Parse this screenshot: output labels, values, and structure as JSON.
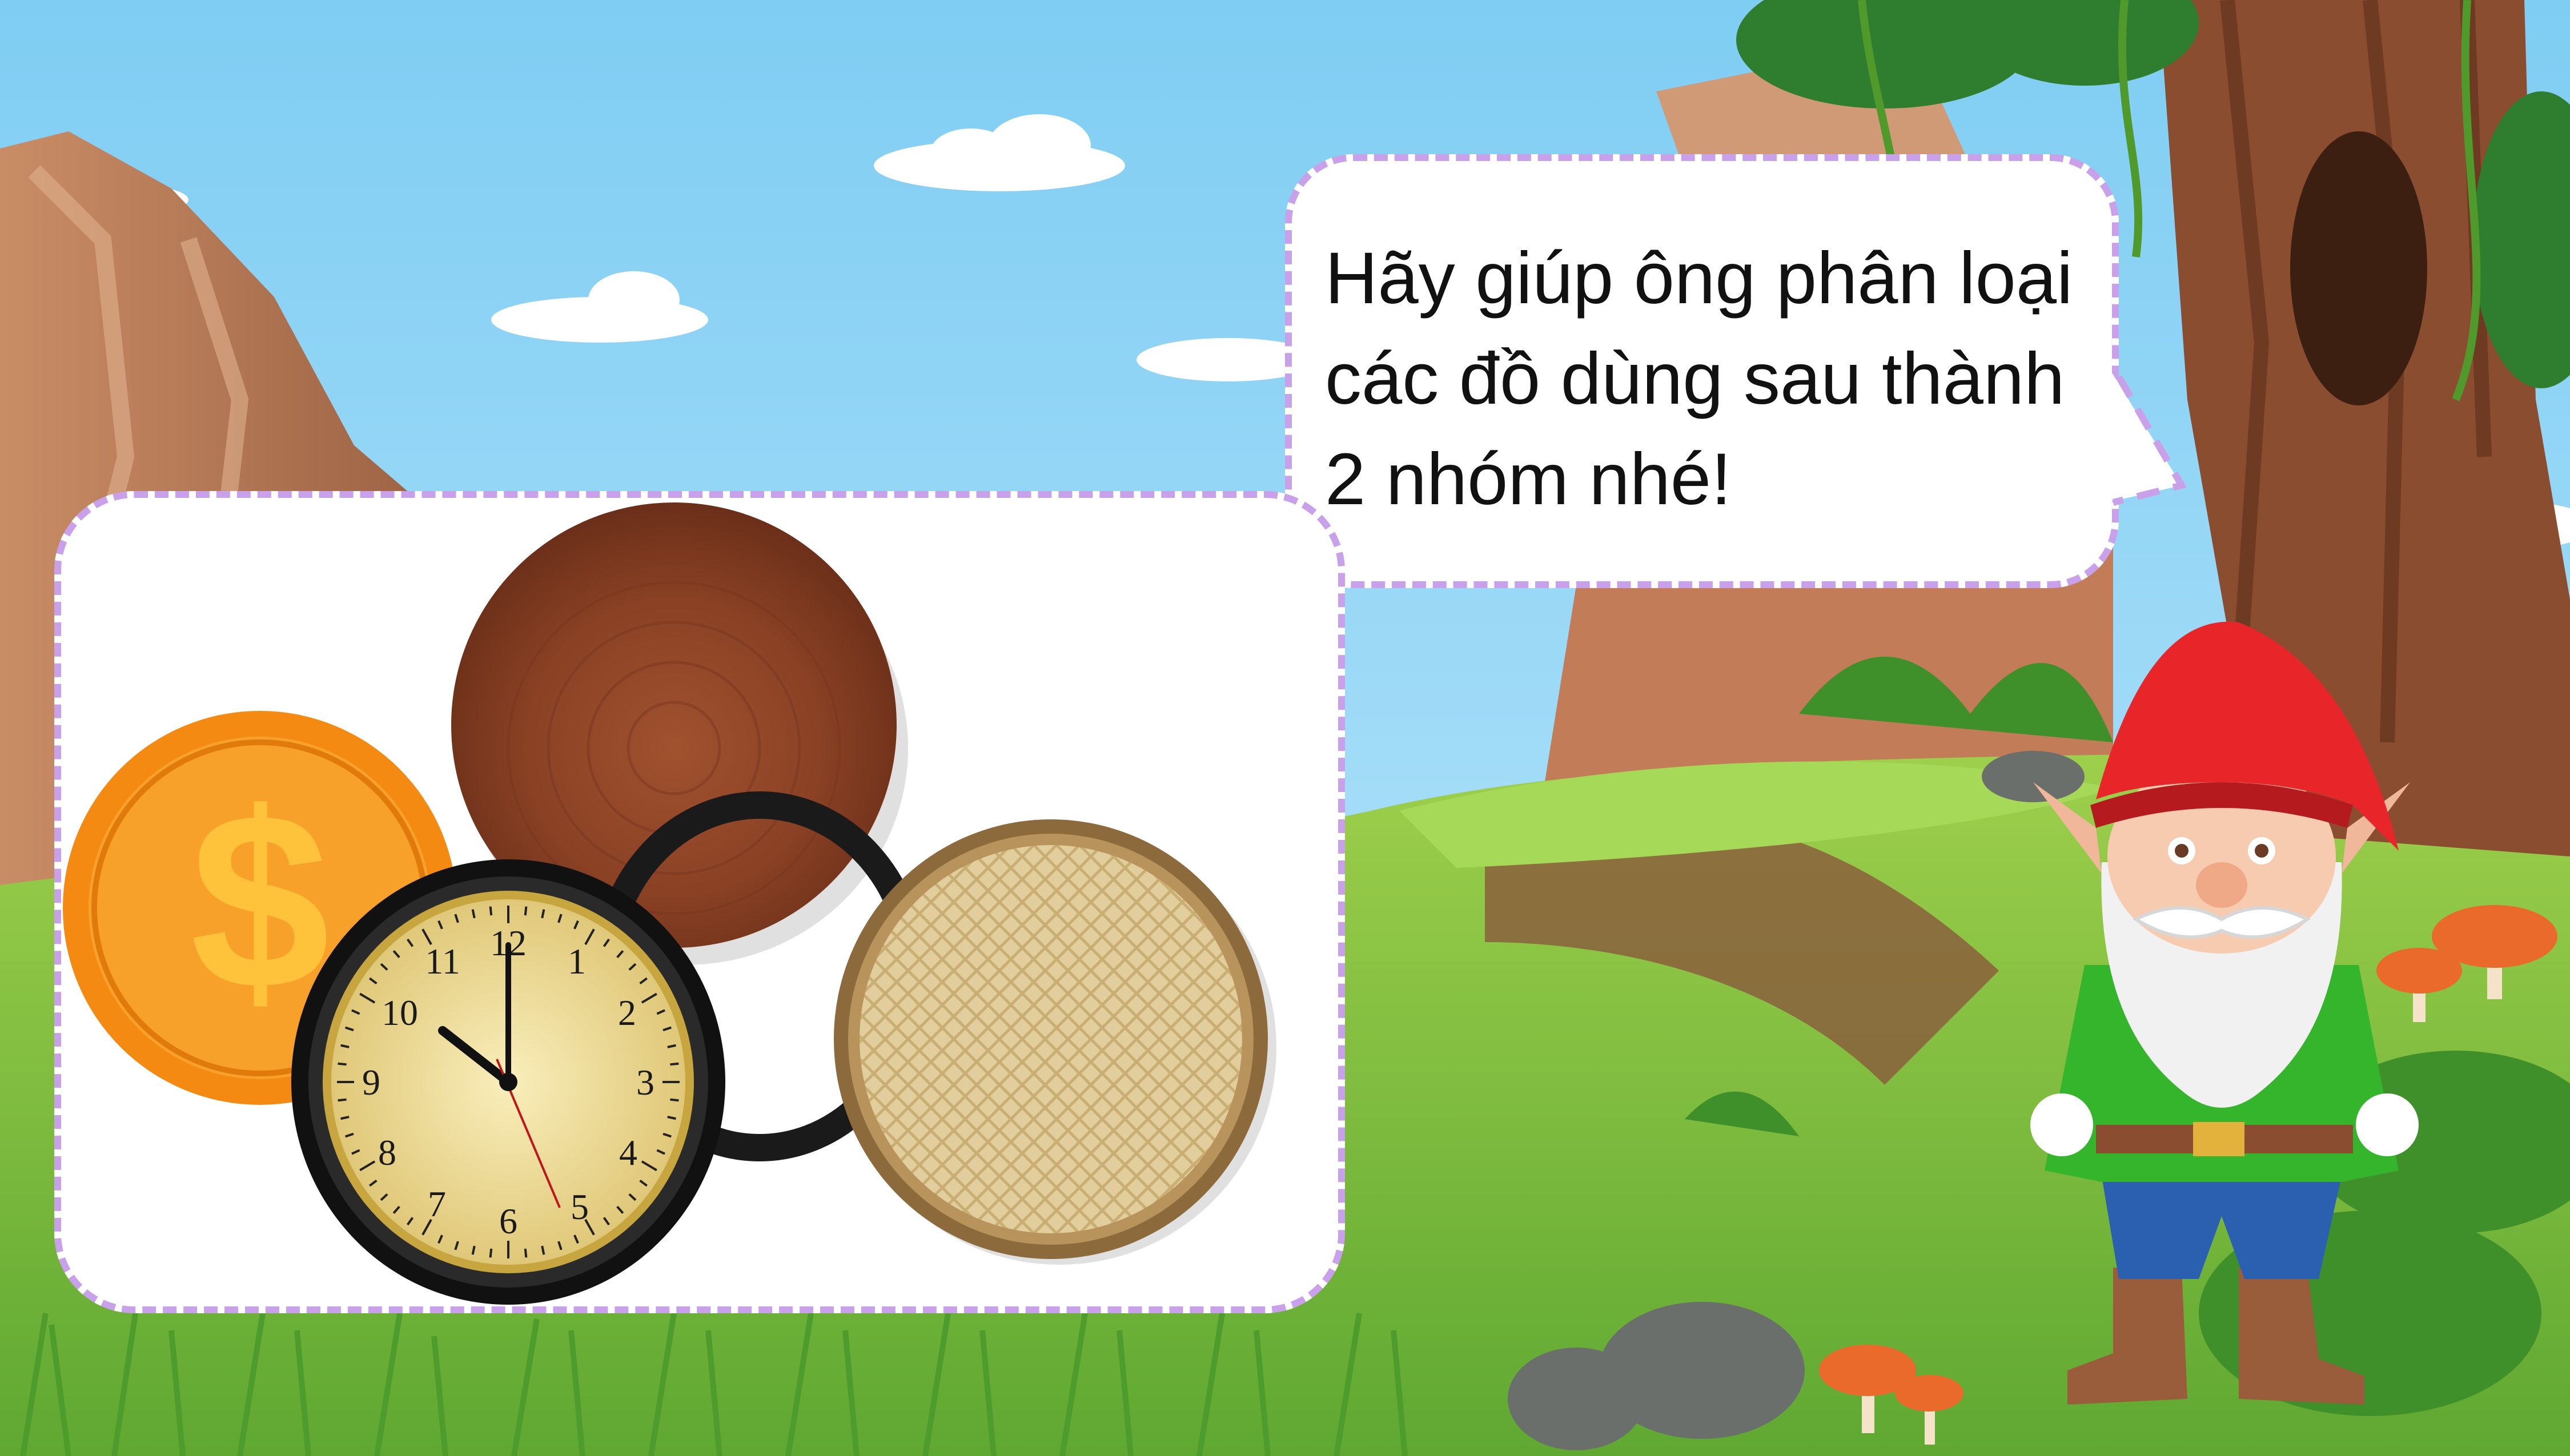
{
  "speech_bubble": {
    "lines": [
      "Hãy giúp ông phân loại",
      "các đồ dùng sau thành",
      "2 nhóm nhé!"
    ],
    "border_color": "#c9a0ea"
  },
  "items": [
    {
      "name": "gold-dollar-coin",
      "symbol": "$"
    },
    {
      "name": "wooden-cutting-board"
    },
    {
      "name": "black-hair-tie"
    },
    {
      "name": "wall-clock",
      "numbers": [
        "12",
        "1",
        "2",
        "3",
        "4",
        "5",
        "6",
        "7",
        "8",
        "9",
        "10",
        "11"
      ]
    },
    {
      "name": "woven-bamboo-tray"
    }
  ],
  "character": {
    "name": "garden-gnome"
  },
  "colors": {
    "sky": "#8fd6f7",
    "grass": "#7cc244",
    "gnome_hat": "#e8262a",
    "gnome_shirt": "#35b52c",
    "coin": "#f7931e"
  }
}
